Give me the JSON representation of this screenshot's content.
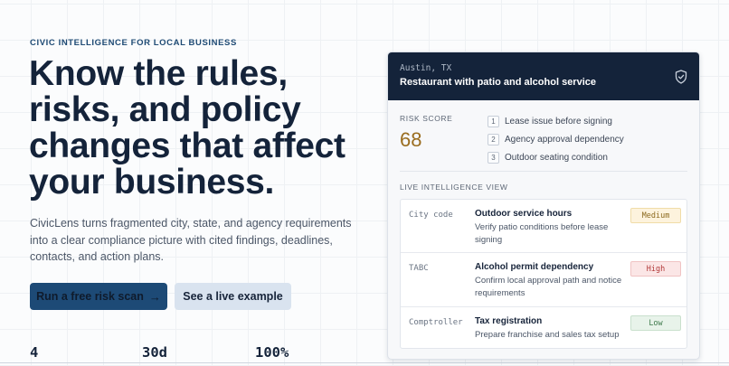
{
  "hero": {
    "eyebrow": "CIVIC INTELLIGENCE FOR LOCAL BUSINESS",
    "headline": "Know the rules, risks, and policy changes that affect your business.",
    "lede": "CivicLens turns fragmented city, state, and agency requirements into a clear compliance picture with cited findings, deadlines, contacts, and action plans.",
    "primary_button": "Run a free risk scan",
    "primary_arrow": "→",
    "secondary_button": "See a live example",
    "stats": [
      "4",
      "30d",
      "100%"
    ]
  },
  "card": {
    "location": "Austin, TX",
    "title": "Restaurant with patio and alcohol service",
    "shield_icon": "shield-check-icon",
    "risk_label": "RISK SCORE",
    "risk_score": "68",
    "issues": [
      {
        "num": "1",
        "text": "Lease issue before signing"
      },
      {
        "num": "2",
        "text": "Agency approval dependency"
      },
      {
        "num": "3",
        "text": "Outdoor seating condition"
      }
    ],
    "live_label": "LIVE INTELLIGENCE VIEW",
    "rows": [
      {
        "source": "City code",
        "title": "Outdoor service hours",
        "desc": "Verify patio conditions before lease signing",
        "badge": "Medium"
      },
      {
        "source": "TABC",
        "title": "Alcohol permit dependency",
        "desc": "Confirm local approval path and notice requirements",
        "badge": "High"
      },
      {
        "source": "Comptroller",
        "title": "Tax registration",
        "desc": "Prepare franchise and sales tax setup",
        "badge": "Low"
      }
    ]
  },
  "colors": {
    "primary": "#1d4a76",
    "navy": "#14233a",
    "risk": "#9a6d1f"
  }
}
